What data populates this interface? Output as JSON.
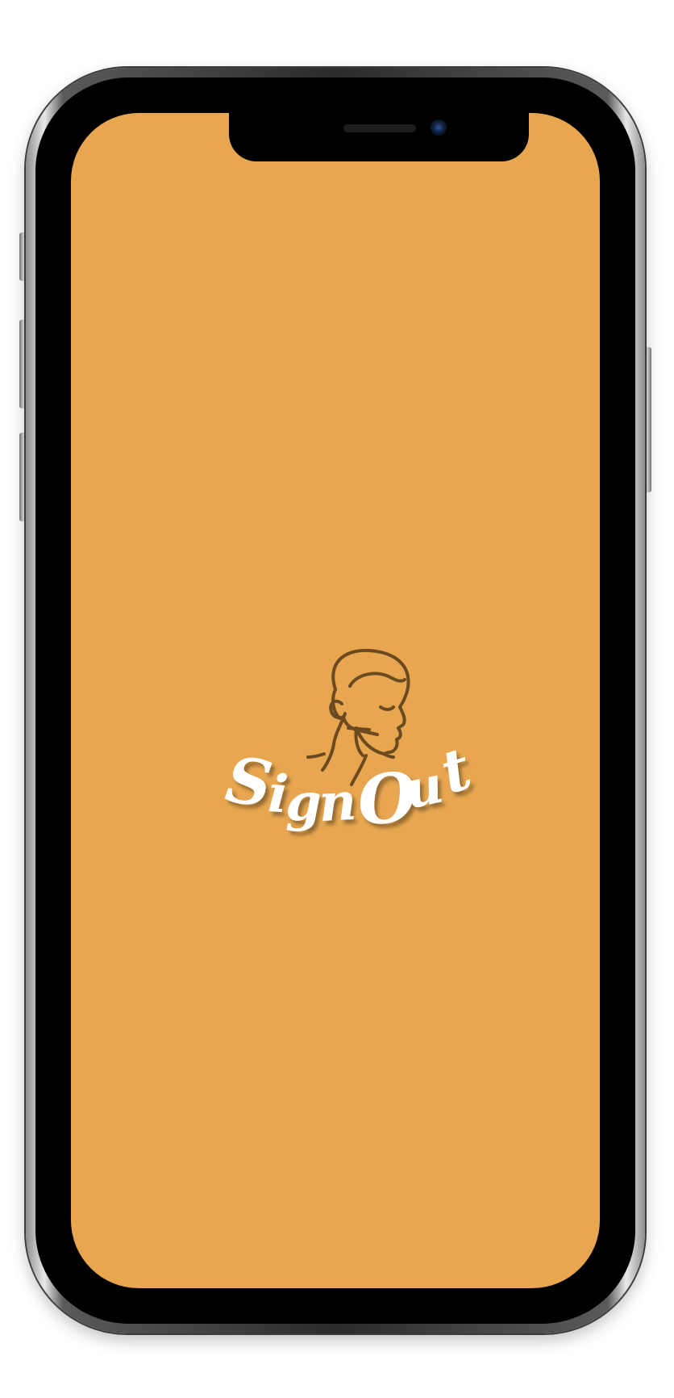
{
  "app": {
    "name": "SignOut",
    "logo_icon": "man-touching-face-icon"
  },
  "colors": {
    "splash_background": "#E7A64F",
    "logo_line": "#6B4A1F",
    "logo_text": "#FFFFFF"
  }
}
